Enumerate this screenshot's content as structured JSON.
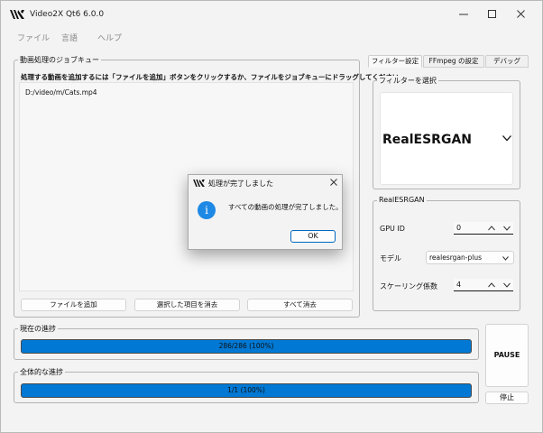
{
  "window": {
    "title": "Video2X Qt6 6.0.0"
  },
  "menu": {
    "items": [
      "ファイル",
      "言語",
      "ヘルプ"
    ]
  },
  "queue_group": {
    "title": "動画処理のジョブキュー",
    "hint": "処理する動画を追加するには「ファイルを追加」ボタンをクリックするか、ファイルをジョブキューにドラッグしてください。",
    "items": [
      "D:/video/m/Cats.mp4"
    ],
    "add_button": "ファイルを追加",
    "remove_selected_button": "選択した項目を消去",
    "clear_all_button": "すべて消去"
  },
  "tabs": [
    {
      "label": "フィルター設定",
      "active": true
    },
    {
      "label": "FFmpeg の設定",
      "active": false
    },
    {
      "label": "デバッグ",
      "active": false
    }
  ],
  "filter_group": {
    "title": "フィルターを選択",
    "selected": "RealESRGAN"
  },
  "realesrgan_group": {
    "title": "RealESRGAN",
    "gpu_label": "GPU ID",
    "gpu_value": "0",
    "model_label": "モデル",
    "model_value": "realesrgan-plus",
    "scale_label": "スケーリング係数",
    "scale_value": "4"
  },
  "current_progress": {
    "title": "現在の進捗",
    "text": "286/286 (100%)",
    "fraction": 1.0
  },
  "overall_progress": {
    "title": "全体的な進捗",
    "text": "1/1 (100%)",
    "fraction": 1.0
  },
  "pause_button": "PAUSE",
  "stop_button": "停止",
  "dialog": {
    "title": "処理が完了しました",
    "message": "すべての動画の処理が完了しました。",
    "ok_button": "OK",
    "info_glyph": "i"
  },
  "colors": {
    "accent": "#0078d4",
    "info_icon": "#1e88e5"
  },
  "icons": [
    "video2x-logo-icon",
    "minimize-icon",
    "maximize-icon",
    "close-icon",
    "chevron-down-icon",
    "spin-up-icon",
    "spin-down-icon",
    "info-icon"
  ]
}
